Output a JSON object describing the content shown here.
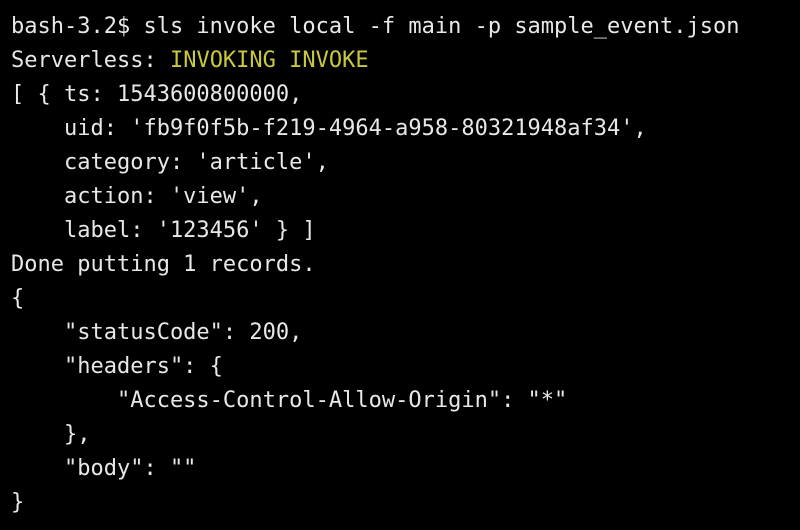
{
  "terminal": {
    "colors": {
      "background": "#000000",
      "text": "#e8e8e8",
      "accent": "#c9c83e"
    },
    "lines": [
      {
        "prefix": "bash-3.2$ sls invoke local -f main -p sample_event.json",
        "accent": ""
      },
      {
        "prefix": "Serverless: ",
        "accent": "INVOKING INVOKE"
      },
      {
        "prefix": "[ { ts: 1543600800000,",
        "accent": ""
      },
      {
        "prefix": "    uid: 'fb9f0f5b-f219-4964-a958-80321948af34',",
        "accent": ""
      },
      {
        "prefix": "    category: 'article',",
        "accent": ""
      },
      {
        "prefix": "    action: 'view',",
        "accent": ""
      },
      {
        "prefix": "    label: '123456' } ]",
        "accent": ""
      },
      {
        "prefix": "Done putting 1 records.",
        "accent": ""
      },
      {
        "prefix": "{",
        "accent": ""
      },
      {
        "prefix": "    \"statusCode\": 200,",
        "accent": ""
      },
      {
        "prefix": "    \"headers\": {",
        "accent": ""
      },
      {
        "prefix": "        \"Access-Control-Allow-Origin\": \"*\"",
        "accent": ""
      },
      {
        "prefix": "    },",
        "accent": ""
      },
      {
        "prefix": "    \"body\": \"\"",
        "accent": ""
      },
      {
        "prefix": "}",
        "accent": ""
      }
    ]
  }
}
